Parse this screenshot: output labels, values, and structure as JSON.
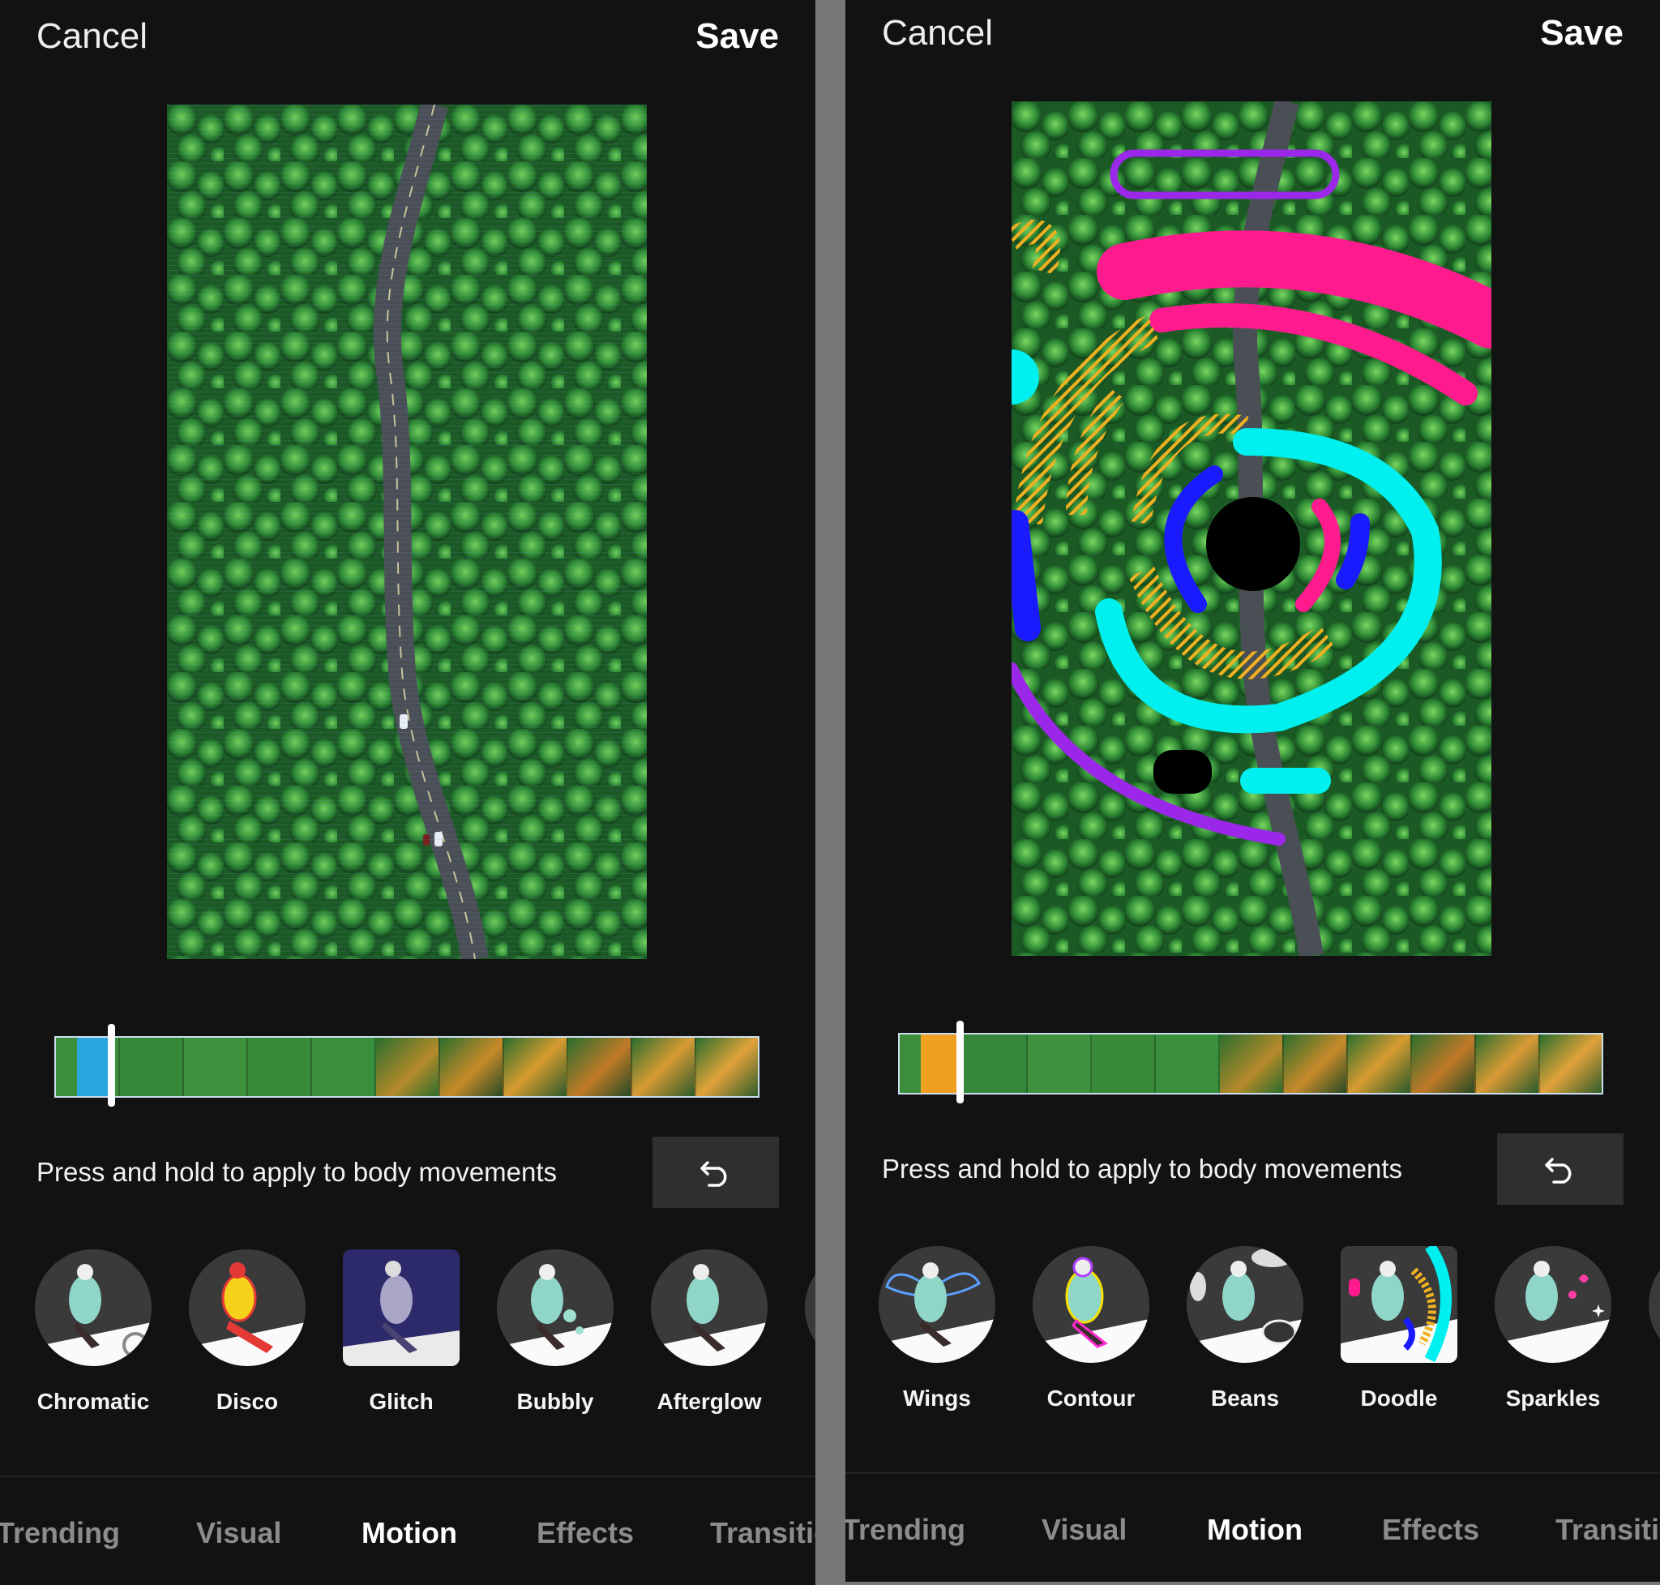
{
  "left": {
    "cancel": "Cancel",
    "save": "Save",
    "hint": "Press and hold to apply to body movements",
    "effects": [
      {
        "label": "Chromatic"
      },
      {
        "label": "Disco"
      },
      {
        "label": "Glitch"
      },
      {
        "label": "Bubbly"
      },
      {
        "label": "Afterglow"
      }
    ],
    "tabs": [
      "Trending",
      "Visual",
      "Motion",
      "Effects",
      "Transitio"
    ],
    "active_tab": "Motion",
    "timeline_mark_color": "#29a8e0"
  },
  "right": {
    "cancel": "Cancel",
    "save": "Save",
    "hint": "Press and hold to apply to body movements",
    "effects": [
      {
        "label": "Wings"
      },
      {
        "label": "Contour"
      },
      {
        "label": "Beans"
      },
      {
        "label": "Doodle"
      },
      {
        "label": "Sparkles"
      }
    ],
    "tabs": [
      "Trending",
      "Visual",
      "Motion",
      "Effects",
      "Transitio"
    ],
    "active_tab": "Motion",
    "timeline_mark_color": "#f0a020"
  },
  "icons": {
    "undo": "undo-arrow-icon"
  },
  "colors": {
    "background": "#121212",
    "undo_bg": "#2f2f2f",
    "inactive_tab": "#8c8c8c"
  }
}
